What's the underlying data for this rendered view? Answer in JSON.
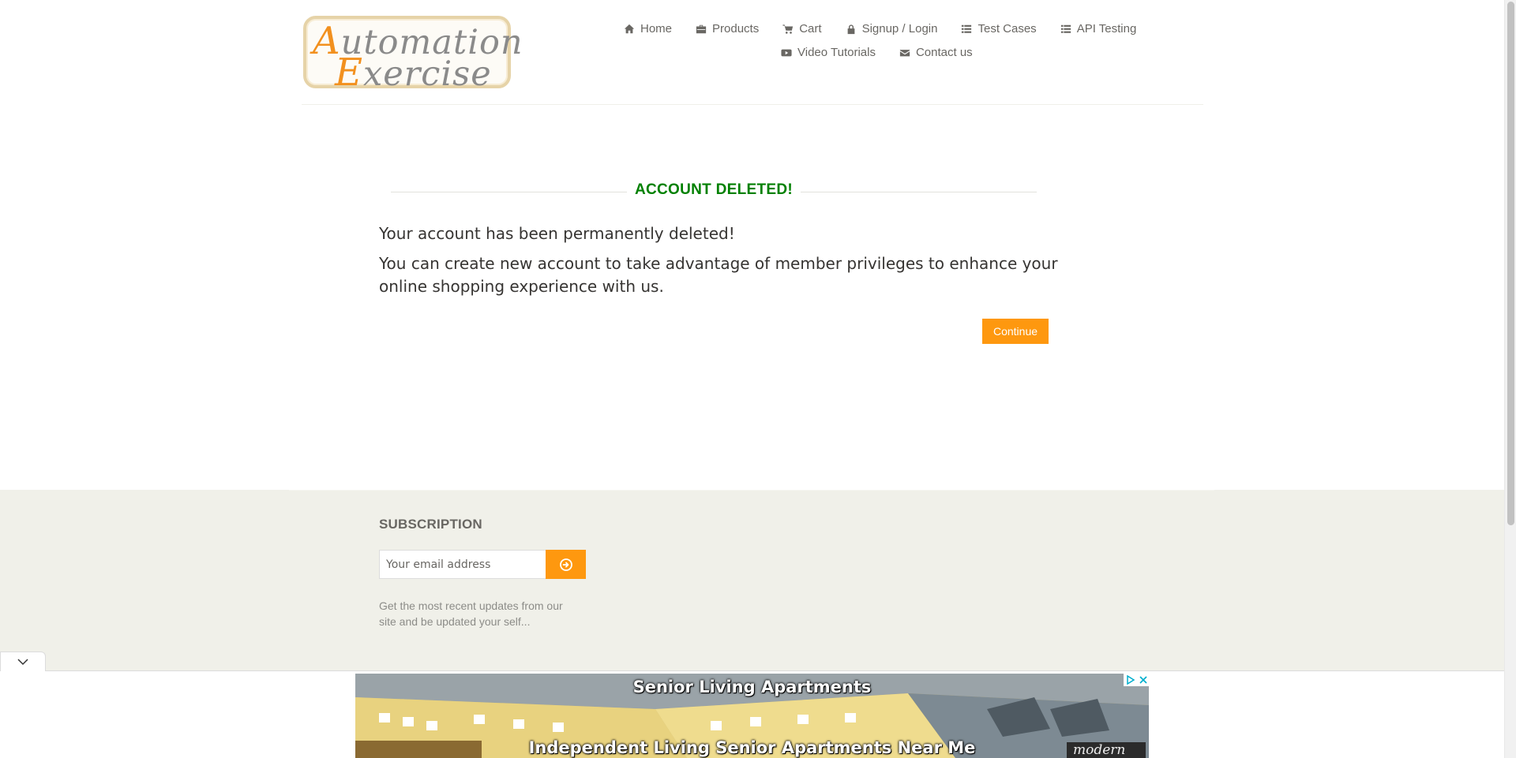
{
  "logo": {
    "line1_cap": "A",
    "line1_rest": "utomation",
    "line2_cap": "E",
    "line2_rest": "xercise"
  },
  "nav": {
    "row1": [
      {
        "label": "Home",
        "icon": "home-icon"
      },
      {
        "label": "Products",
        "icon": "briefcase-icon"
      },
      {
        "label": "Cart",
        "icon": "cart-icon"
      },
      {
        "label": "Signup / Login",
        "icon": "lock-icon"
      },
      {
        "label": "Test Cases",
        "icon": "list-icon"
      },
      {
        "label": "API Testing",
        "icon": "list-icon"
      }
    ],
    "row2": [
      {
        "label": "Video Tutorials",
        "icon": "youtube-play-icon"
      },
      {
        "label": "Contact us",
        "icon": "envelope-icon"
      }
    ]
  },
  "main": {
    "title": "ACCOUNT DELETED!",
    "message1": "Your account has been permanently deleted!",
    "message2": "You can create new account to take advantage of member privileges to enhance your online shopping experience with us.",
    "continue_label": "Continue"
  },
  "footer": {
    "subscription_title": "SUBSCRIPTION",
    "email_placeholder": "Your email address",
    "note": "Get the most recent updates from our site and be updated your self..."
  },
  "ad": {
    "headline": "Senior Living Apartments",
    "subline": "Independent Living Senior Apartments Near Me",
    "brand": "modern"
  },
  "colors": {
    "accent": "#fe980f",
    "success": "#008000",
    "footer_bg": "#f0f0e9"
  }
}
